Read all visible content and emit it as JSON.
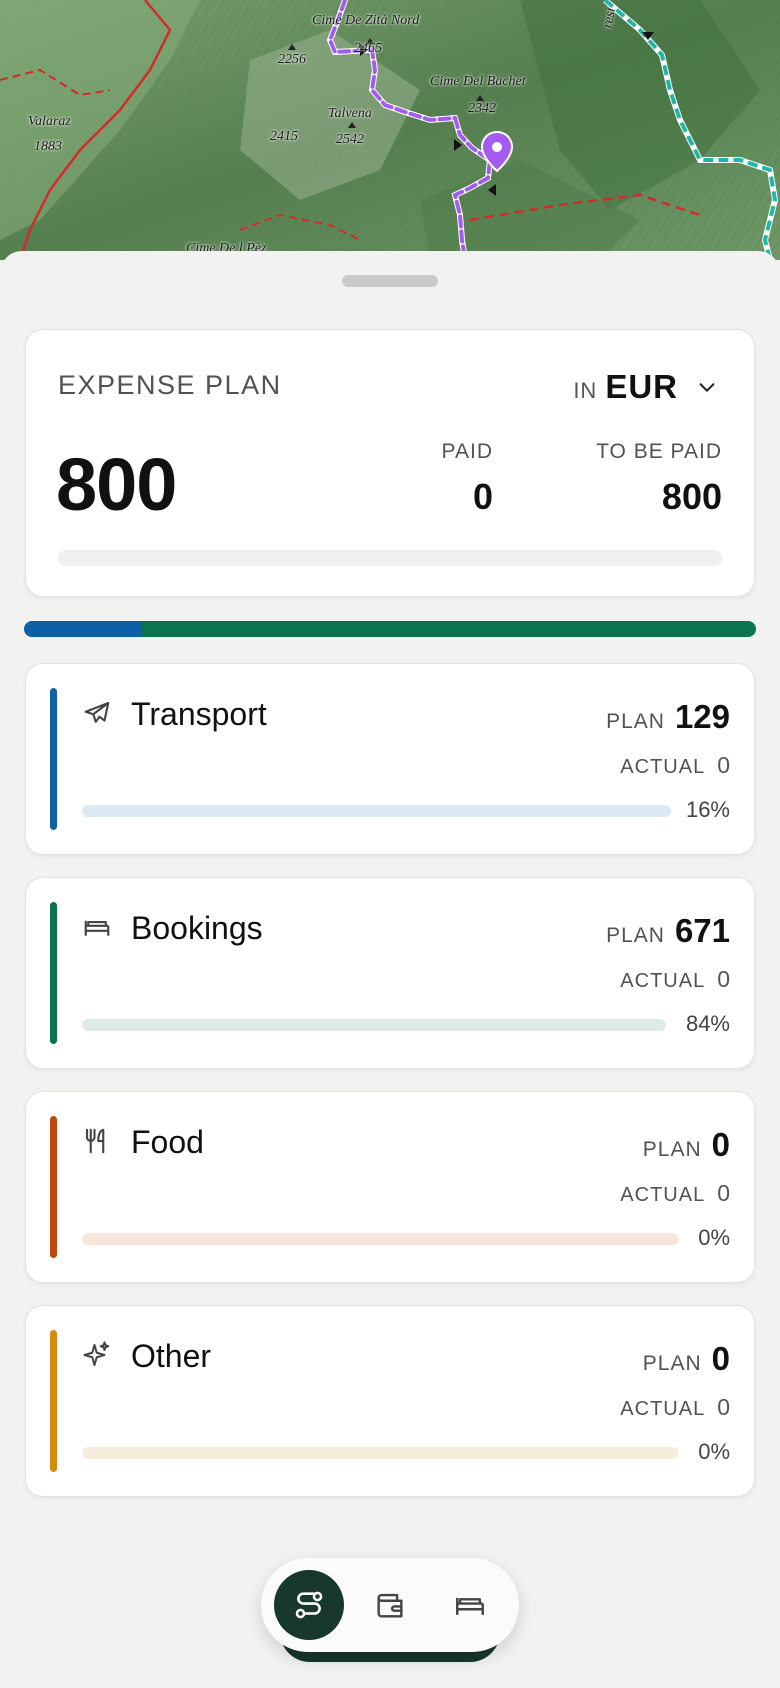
{
  "map": {
    "labels": {
      "zita_nord": "Cime De Zità Nord",
      "peak_2256": "2256",
      "peak_2465": "2465",
      "bachet": "Cime Del Bachet",
      "peak_2342": "2342",
      "talvena": "Talvena",
      "peak_2415": "2415",
      "peak_2542": "2542",
      "valaraz": "Valaraz",
      "peak_1883": "1883",
      "pez": "Cime De l Pèz",
      "edge_label": "resi"
    },
    "colors": {
      "terrain": "#5e8a58",
      "boundary": "#d12b2b",
      "route": "#a45cf0",
      "trail": "#1fb5a8"
    }
  },
  "summary": {
    "title": "EXPENSE PLAN",
    "currency_prefix": "IN",
    "currency": "EUR",
    "total": "800",
    "paid_label": "PAID",
    "paid_value": "0",
    "due_label": "TO BE PAID",
    "due_value": "800"
  },
  "split": [
    {
      "category": "transport",
      "fraction": 0.16,
      "color": "#0d5fa8"
    },
    {
      "category": "bookings",
      "fraction": 0.84,
      "color": "#0a7350"
    }
  ],
  "categories": [
    {
      "name": "Transport",
      "icon": "airplane-icon",
      "plan_label": "PLAN",
      "plan": "129",
      "actual_label": "ACTUAL",
      "actual": "0",
      "percent": "16%",
      "color": "#0d5fa8",
      "track": "#dde9f3"
    },
    {
      "name": "Bookings",
      "icon": "bed-icon",
      "plan_label": "PLAN",
      "plan": "671",
      "actual_label": "ACTUAL",
      "actual": "0",
      "percent": "84%",
      "color": "#0a7350",
      "track": "#dcebe6"
    },
    {
      "name": "Food",
      "icon": "utensils-icon",
      "plan_label": "PLAN",
      "plan": "0",
      "actual_label": "ACTUAL",
      "actual": "0",
      "percent": "0%",
      "color": "#bd4a0d",
      "track": "#f6e6dc"
    },
    {
      "name": "Other",
      "icon": "sparkles-icon",
      "plan_label": "PLAN",
      "plan": "0",
      "actual_label": "ACTUAL",
      "actual": "0",
      "percent": "0%",
      "color": "#d58a10",
      "track": "#f7eddc"
    }
  ],
  "nav": {
    "items": [
      {
        "icon": "route-icon",
        "active": true
      },
      {
        "icon": "wallet-icon",
        "active": false
      },
      {
        "icon": "bed-icon",
        "active": false
      }
    ],
    "active_color": "#17382a"
  }
}
